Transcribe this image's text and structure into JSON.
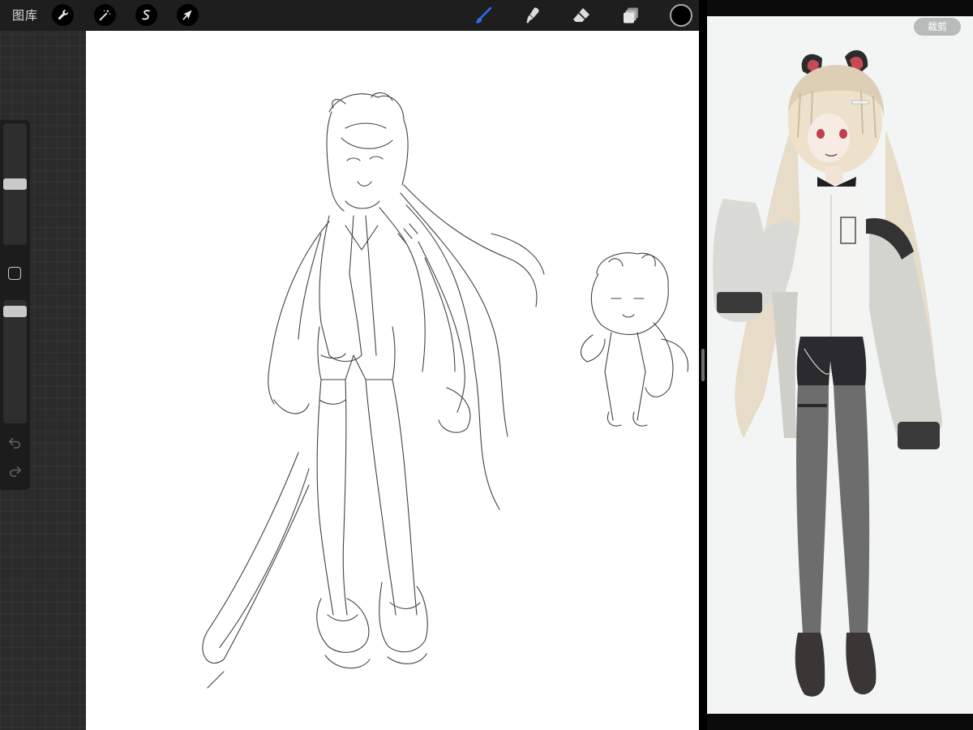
{
  "topbar": {
    "gallery_label": "图库",
    "left_tools": [
      {
        "icon": "wrench-icon",
        "label": "actions"
      },
      {
        "icon": "magic-wand-icon",
        "label": "adjustments"
      },
      {
        "icon": "selection-s-icon",
        "label": "selection"
      },
      {
        "icon": "arrow-cursor-icon",
        "label": "transform"
      }
    ],
    "right_tools": [
      {
        "icon": "brush-icon",
        "active": true
      },
      {
        "icon": "smudge-icon",
        "active": false
      },
      {
        "icon": "eraser-icon",
        "active": false
      },
      {
        "icon": "layers-icon",
        "active": false
      }
    ],
    "current_color": "#000000",
    "accent_color": "#2f6fe8"
  },
  "sidebar": {
    "brush_size_level": 0.5,
    "opacity_level": 0.95,
    "icons": [
      "modify-square-icon",
      "undo-icon",
      "redo-icon"
    ]
  },
  "reference": {
    "crop_label": "裁剪"
  }
}
